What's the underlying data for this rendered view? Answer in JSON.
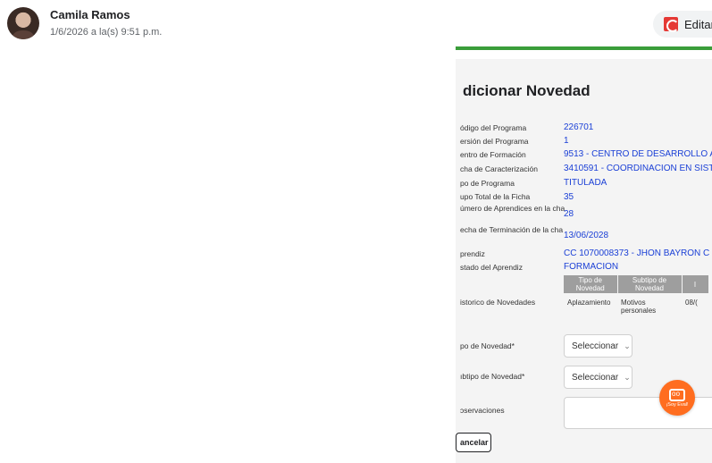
{
  "post": {
    "author": "Camila Ramos",
    "timestamp": "1/6/2026 a la(s) 9:51 p.m.",
    "edit_label": "Editar"
  },
  "form": {
    "title": "dicionar Novedad",
    "fields": [
      {
        "label": "ódigo del Programa",
        "value": "226701"
      },
      {
        "label": "ersión del Programa",
        "value": "1"
      },
      {
        "label": "entro de Formación",
        "value": "9513 - CENTRO DE DESARROLLO A"
      },
      {
        "label": "cha de Caracterización",
        "value": "3410591 - COORDINACION EN SIST"
      },
      {
        "label": "po de Programa",
        "value": "TITULADA"
      },
      {
        "label": "upo Total de la Ficha",
        "value": "35"
      },
      {
        "label": "úmero de Aprendices en la cha",
        "value": "28"
      },
      {
        "label": "echa de Terminación de la cha",
        "value": "13/06/2028"
      },
      {
        "label": "prendiz",
        "value": "CC 1070008373 - JHON BAYRON C"
      },
      {
        "label": "stado del Aprendiz",
        "value": "FORMACION"
      }
    ],
    "history": {
      "label": "istorico de Novedades",
      "headers": [
        "Tipo de Novedad",
        "Subtipo de Novedad",
        "I"
      ],
      "row": [
        "Aplazamiento",
        "Motivos personales",
        "08/("
      ]
    },
    "tipo_label": "po de Novedad*",
    "subtipo_label": "ıbtipo de Novedad*",
    "select_placeholder": "Seleccionar",
    "observaciones_label": "ɔservaciones",
    "cancel_label": "ancelar"
  },
  "chatbot": {
    "label": "¡Soy Eval!",
    "color": "#ff6d1f"
  }
}
